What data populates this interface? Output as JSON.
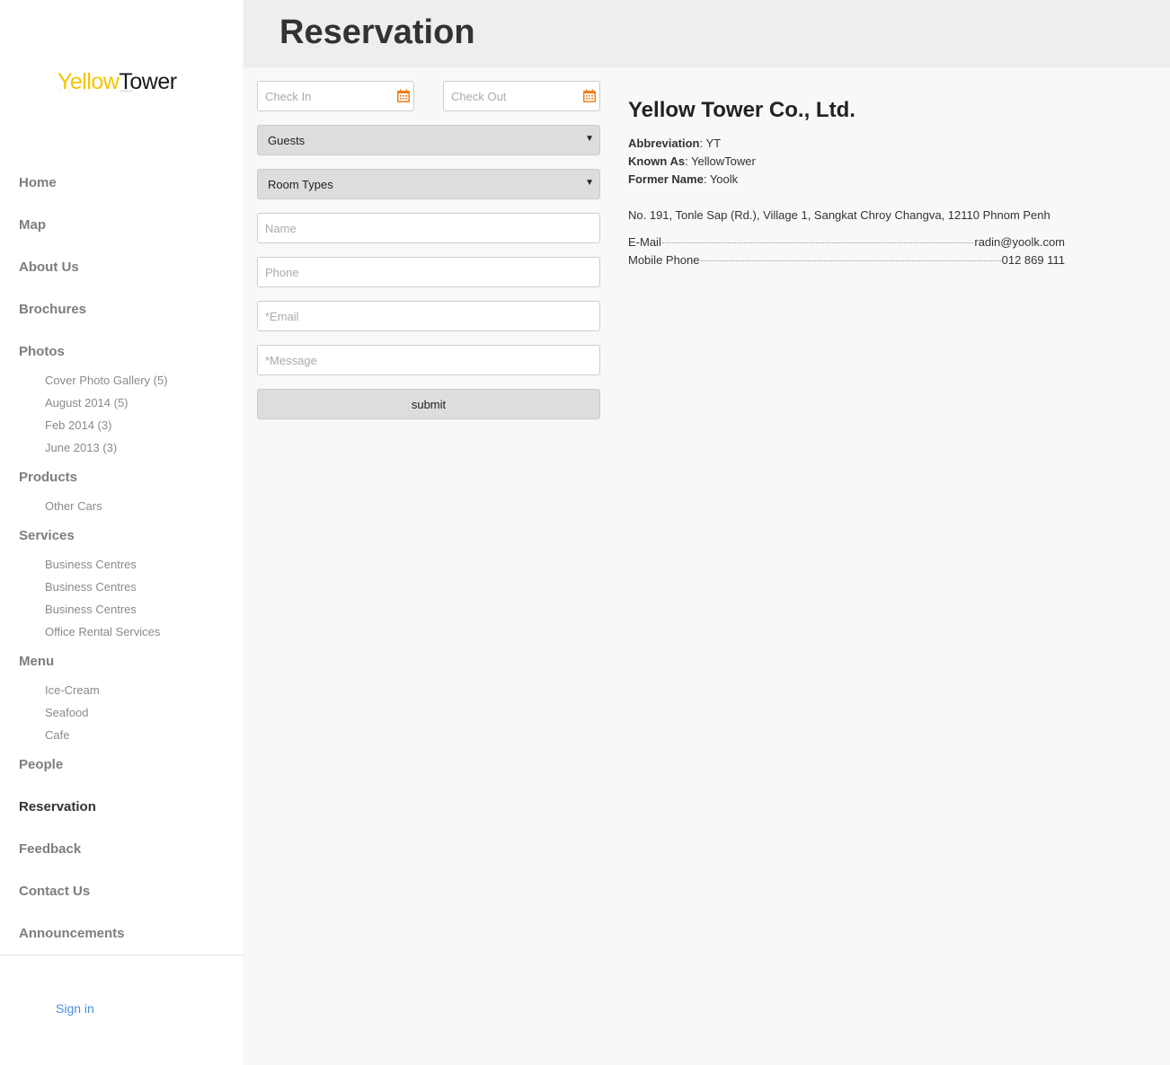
{
  "logo": {
    "part1": "Yellow",
    "part2": "Tower"
  },
  "header": {
    "title": "Reservation"
  },
  "sidebar": {
    "items": [
      {
        "label": "Home"
      },
      {
        "label": "Map"
      },
      {
        "label": "About Us"
      },
      {
        "label": "Brochures"
      },
      {
        "label": "Photos",
        "children": [
          "Cover Photo Gallery (5)",
          "August 2014 (5)",
          "Feb 2014 (3)",
          "June 2013 (3)"
        ]
      },
      {
        "label": "Products",
        "children": [
          "Other Cars"
        ]
      },
      {
        "label": "Services",
        "children": [
          "Business Centres",
          "Business Centres",
          "Business Centres",
          "Office Rental Services"
        ]
      },
      {
        "label": "Menu",
        "children": [
          "Ice-Cream",
          "Seafood",
          "Cafe"
        ]
      },
      {
        "label": "People"
      },
      {
        "label": "Reservation",
        "active": true
      },
      {
        "label": "Feedback"
      },
      {
        "label": "Contact Us"
      },
      {
        "label": "Announcements"
      }
    ],
    "signin": "Sign in"
  },
  "form": {
    "checkin_placeholder": "Check In",
    "checkout_placeholder": "Check Out",
    "guests_label": "Guests",
    "roomtypes_label": "Room Types",
    "name_placeholder": "Name",
    "phone_placeholder": "Phone",
    "email_placeholder": "*Email",
    "message_placeholder": "*Message",
    "submit_label": "submit",
    "dropdown_arrow": "▼"
  },
  "company": {
    "name": "Yellow Tower Co., Ltd.",
    "abbreviation_label": "Abbreviation",
    "abbreviation": "YT",
    "known_as_label": "Known As",
    "known_as": "YellowTower",
    "former_name_label": "Former Name",
    "former_name": "Yoolk",
    "address": "No. 191, Tonle Sap (Rd.), Village 1, Sangkat Chroy Changva, 12110 Phnom Penh",
    "email_label": "E-Mail",
    "email": "radin@yoolk.com",
    "mobile_label": "Mobile Phone",
    "mobile": "012 869 111"
  },
  "colors": {
    "accent_orange": "#f07f1a",
    "logo_yellow": "#f5c400",
    "link_blue": "#4a90d9"
  }
}
